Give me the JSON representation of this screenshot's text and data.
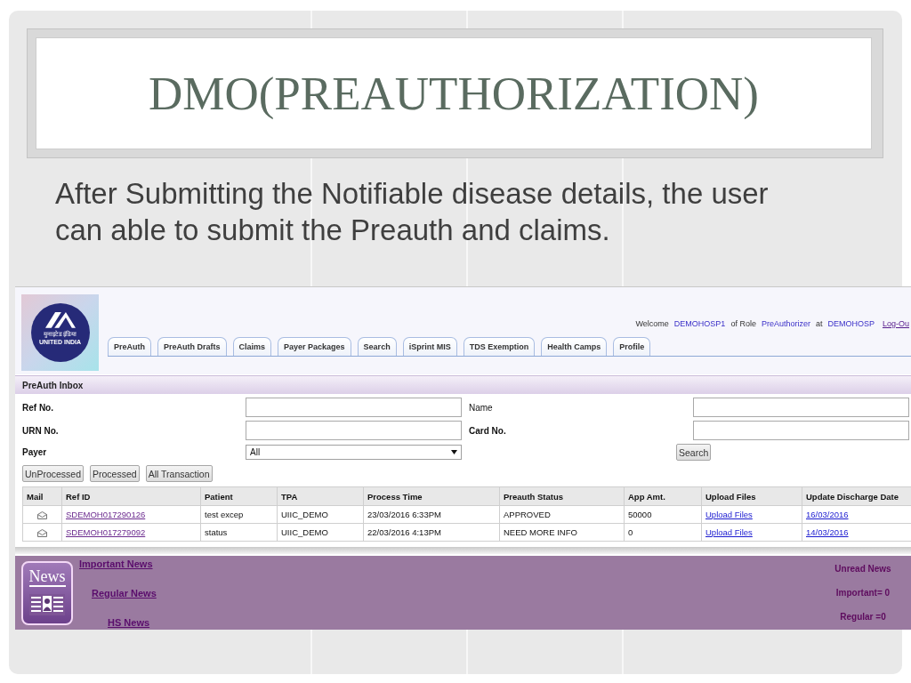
{
  "slide": {
    "title": "DMO(PREAUTHORIZATION)",
    "text": "After Submitting the Notifiable disease details, the user can able to submit the Preauth and claims."
  },
  "app": {
    "logo": {
      "hindi": "युनाइटेड इंडिया",
      "name": "UNITED INDIA"
    },
    "welcome": [
      {
        "kind": "plain",
        "text": "Welcome"
      },
      {
        "kind": "value",
        "text": "DEMOHOSP1"
      },
      {
        "kind": "plain",
        "text": "of Role"
      },
      {
        "kind": "value",
        "text": "PreAuthorizer"
      },
      {
        "kind": "plain",
        "text": "at"
      },
      {
        "kind": "value",
        "text": "DEMOHOSP"
      },
      {
        "kind": "link",
        "text": "Log-Ou"
      }
    ],
    "tabs": [
      {
        "label": "PreAuth",
        "selected": false
      },
      {
        "label": "PreAuth Drafts",
        "selected": false
      },
      {
        "label": "Claims",
        "selected": false
      },
      {
        "label": "Payer Packages",
        "selected": false
      },
      {
        "label": "Search",
        "selected": false
      },
      {
        "label": "iSprint MIS",
        "selected": false
      },
      {
        "label": "TDS Exemption",
        "selected": false
      },
      {
        "label": "Health Camps",
        "selected": false
      },
      {
        "label": "Profile",
        "selected": false
      }
    ],
    "inbox_title": "PreAuth Inbox",
    "filters": [
      {
        "kind": "input",
        "label": "Ref No.",
        "bold": true
      },
      {
        "kind": "input",
        "label": "Name",
        "bold": false
      },
      {
        "kind": "input",
        "label": "URN No.",
        "bold": true
      },
      {
        "kind": "input",
        "label": "Card No.",
        "bold": true
      },
      {
        "kind": "select",
        "label": "Payer",
        "bold": true,
        "value": "All"
      },
      {
        "kind": "button",
        "label": "Search"
      }
    ],
    "view_buttons": [
      "UnProcessed",
      "Processed",
      "All Transaction"
    ],
    "table": {
      "columns": [
        "Mail",
        "Ref ID",
        "Patient",
        "TPA",
        "Process Time",
        "Preauth Status",
        "App Amt.",
        "Upload Files",
        "Update Discharge Date"
      ],
      "rows": [
        {
          "cells": [
            {
              "kind": "mail"
            },
            {
              "kind": "link",
              "visited": true,
              "text": "SDEMOH017290126"
            },
            {
              "kind": "text",
              "text": "test excep"
            },
            {
              "kind": "text",
              "text": "UIIC_DEMO"
            },
            {
              "kind": "text",
              "text": "23/03/2016 6:33PM"
            },
            {
              "kind": "text",
              "text": "APPROVED"
            },
            {
              "kind": "text",
              "text": "50000"
            },
            {
              "kind": "link",
              "visited": false,
              "text": "Upload Files"
            },
            {
              "kind": "link",
              "visited": false,
              "text": "16/03/2016"
            }
          ]
        },
        {
          "cells": [
            {
              "kind": "mail"
            },
            {
              "kind": "link",
              "visited": true,
              "text": "SDEMOH017279092"
            },
            {
              "kind": "text",
              "text": "status"
            },
            {
              "kind": "text",
              "text": "UIIC_DEMO"
            },
            {
              "kind": "text",
              "text": "22/03/2016 4:13PM"
            },
            {
              "kind": "text",
              "text": "NEED MORE INFO"
            },
            {
              "kind": "text",
              "text": "0"
            },
            {
              "kind": "link",
              "visited": false,
              "text": "Upload Files"
            },
            {
              "kind": "link",
              "visited": false,
              "text": "14/03/2016"
            }
          ]
        }
      ]
    },
    "news": {
      "tile_label": "News",
      "links": [
        "Important News",
        "Regular News",
        "HS News"
      ],
      "unread": [
        "Unread News",
        "Important= 0",
        "Regular =0"
      ]
    }
  }
}
